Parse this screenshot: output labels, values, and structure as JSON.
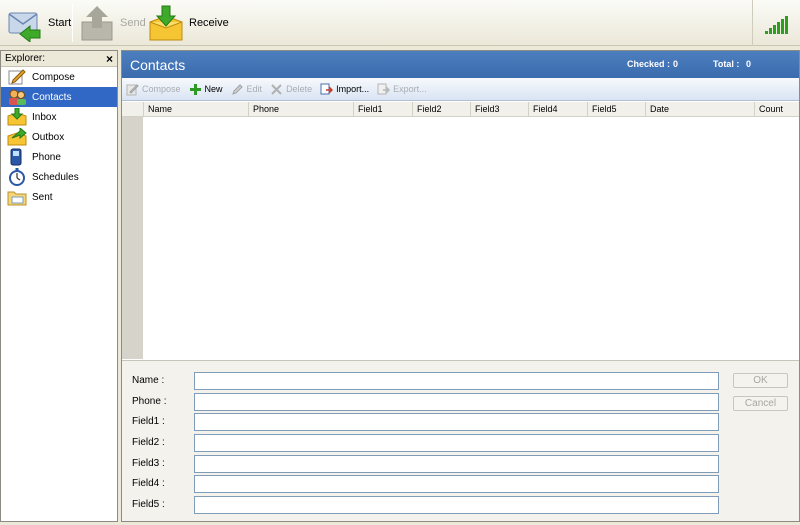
{
  "toolbar": {
    "start_label": "Start",
    "send_label": "Send",
    "receive_label": "Receive"
  },
  "explorer": {
    "title": "Explorer:",
    "items": [
      {
        "label": "Compose",
        "icon": "compose-icon"
      },
      {
        "label": "Contacts",
        "icon": "contacts-icon",
        "selected": true
      },
      {
        "label": "Inbox",
        "icon": "inbox-icon"
      },
      {
        "label": "Outbox",
        "icon": "outbox-icon"
      },
      {
        "label": "Phone",
        "icon": "phone-icon"
      },
      {
        "label": "Schedules",
        "icon": "stopwatch-icon"
      },
      {
        "label": "Sent",
        "icon": "sent-icon"
      }
    ]
  },
  "main": {
    "title": "Contacts",
    "checked_label": "Checked :",
    "checked_value": "0",
    "total_label": "Total :",
    "total_value": "0"
  },
  "actions": {
    "compose": "Compose",
    "new": "New",
    "edit": "Edit",
    "delete": "Delete",
    "import": "Import...",
    "export": "Export..."
  },
  "grid": {
    "columns": [
      "Name",
      "Phone",
      "Field1",
      "Field2",
      "Field3",
      "Field4",
      "Field5",
      "Date",
      "Count"
    ]
  },
  "form": {
    "fields": [
      {
        "label": "Name :",
        "value": ""
      },
      {
        "label": "Phone :",
        "value": ""
      },
      {
        "label": "Field1 :",
        "value": ""
      },
      {
        "label": "Field2 :",
        "value": ""
      },
      {
        "label": "Field3 :",
        "value": ""
      },
      {
        "label": "Field4 :",
        "value": ""
      },
      {
        "label": "Field5 :",
        "value": ""
      }
    ],
    "ok_label": "OK",
    "cancel_label": "Cancel"
  },
  "colors": {
    "header_blue": "#3a6bae",
    "selection_blue": "#3168c5",
    "signal_green": "#2d9e1f"
  }
}
